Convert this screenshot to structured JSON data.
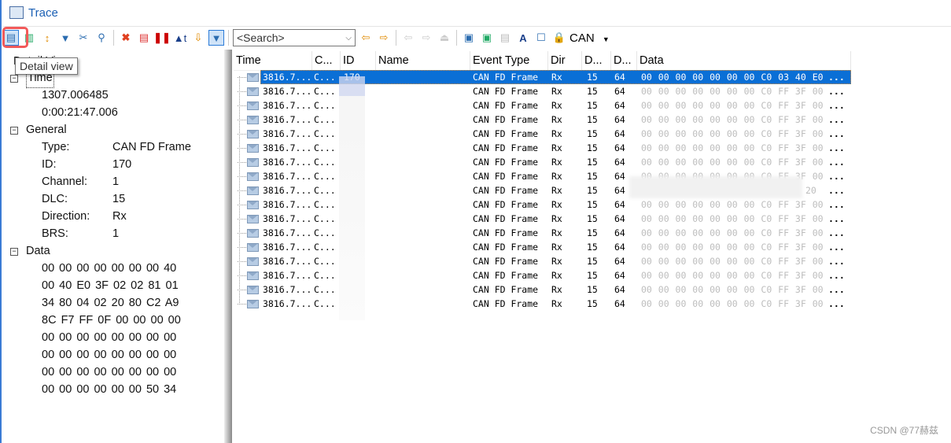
{
  "window": {
    "title": "Trace"
  },
  "toolbar": {
    "buttons": [
      "detail-view",
      "statistics",
      "expand",
      "filter-message",
      "filter-clear",
      "find",
      "delete",
      "clear-filter",
      "pause",
      "time-mode",
      "export",
      "filter-active"
    ],
    "search_placeholder": "<Search>",
    "bus_label": "CAN",
    "tooltip": "Detail view"
  },
  "detail": {
    "title": "Detail View",
    "time": {
      "label": "Time",
      "values": [
        "1307.006485",
        "0:00:21:47.006"
      ]
    },
    "general": {
      "label": "General",
      "fields": [
        {
          "k": "Type:",
          "v": "CAN FD Frame"
        },
        {
          "k": "ID:",
          "v": "170"
        },
        {
          "k": "Channel:",
          "v": "1"
        },
        {
          "k": "DLC:",
          "v": "15"
        },
        {
          "k": "Direction:",
          "v": "Rx"
        },
        {
          "k": "BRS:",
          "v": "1"
        }
      ]
    },
    "data": {
      "label": "Data",
      "lines": [
        "00 00 00 00 00 00 00 40",
        "00 40 E0 3F 02 02 81 01",
        "34 80 04 02 20 80 C2 A9",
        "8C F7 FF 0F 00 00 00 00",
        "00 00 00 00 00 00 00 00",
        "00 00 00 00 00 00 00 00",
        "00 00 00 00 00 00 00 00",
        "00 00 00 00 00 00 50 34"
      ]
    }
  },
  "trace": {
    "columns": [
      "Time",
      "C...",
      "ID",
      "Name",
      "Event Type",
      "Dir",
      "D...",
      "D...",
      "Data"
    ],
    "rows": [
      {
        "time": "3816.7...",
        "ch": "C...",
        "id": "170",
        "type": "CAN FD Frame",
        "dir": "Rx",
        "dlc": "15",
        "len": "64",
        "data": "00 00 00 00 00 00 00 C0 03 40 E0",
        "more": "...",
        "selected": true
      },
      {
        "time": "3816.7...",
        "ch": "C...",
        "id": "",
        "type": "CAN FD Frame",
        "dir": "Rx",
        "dlc": "15",
        "len": "64",
        "data": "00 00 00 00 00 00 00 C0 FF 3F 00",
        "more": "..."
      },
      {
        "time": "3816.7...",
        "ch": "C...",
        "id": "",
        "type": "CAN FD Frame",
        "dir": "Rx",
        "dlc": "15",
        "len": "64",
        "data": "00 00 00 00 00 00 00 C0 FF 3F 00",
        "more": "..."
      },
      {
        "time": "3816.7...",
        "ch": "C...",
        "id": "",
        "type": "CAN FD Frame",
        "dir": "Rx",
        "dlc": "15",
        "len": "64",
        "data": "00 00 00 00 00 00 00 C0 FF 3F 00",
        "more": "..."
      },
      {
        "time": "3816.7...",
        "ch": "C...",
        "id": "",
        "type": "CAN FD Frame",
        "dir": "Rx",
        "dlc": "15",
        "len": "64",
        "data": "00 00 00 00 00 00 00 C0 FF 3F 00",
        "more": "..."
      },
      {
        "time": "3816.7...",
        "ch": "C...",
        "id": "",
        "type": "CAN FD Frame",
        "dir": "Rx",
        "dlc": "15",
        "len": "64",
        "data": "00 00 00 00 00 00 00 C0 FF 3F 00",
        "more": "..."
      },
      {
        "time": "3816.7...",
        "ch": "C...",
        "id": "",
        "type": "CAN FD Frame",
        "dir": "Rx",
        "dlc": "15",
        "len": "64",
        "data": "00 00 00 00 00 00 00 C0 FF 3F 00",
        "more": "..."
      },
      {
        "time": "3816.7...",
        "ch": "C...",
        "id": "",
        "type": "CAN FD Frame",
        "dir": "Rx",
        "dlc": "15",
        "len": "64",
        "data": "00 00 00 00 00 00 00 C0 FF 3F 00",
        "more": "..."
      },
      {
        "time": "3816.7...",
        "ch": "C...",
        "id": "",
        "type": "CAN FD Frame",
        "dir": "Rx",
        "dlc": "15",
        "len": "64",
        "data": "20",
        "more": "..."
      },
      {
        "time": "3816.7...",
        "ch": "C...",
        "id": "",
        "type": "CAN FD Frame",
        "dir": "Rx",
        "dlc": "15",
        "len": "64",
        "data": "00 00 00 00 00 00 00 C0 FF 3F 00",
        "more": "..."
      },
      {
        "time": "3816.7...",
        "ch": "C...",
        "id": "",
        "type": "CAN FD Frame",
        "dir": "Rx",
        "dlc": "15",
        "len": "64",
        "data": "00 00 00 00 00 00 00 C0 FF 3F 00",
        "more": "..."
      },
      {
        "time": "3816.7...",
        "ch": "C...",
        "id": "",
        "type": "CAN FD Frame",
        "dir": "Rx",
        "dlc": "15",
        "len": "64",
        "data": "00 00 00 00 00 00 00 C0 FF 3F 00",
        "more": "..."
      },
      {
        "time": "3816.7...",
        "ch": "C...",
        "id": "",
        "type": "CAN FD Frame",
        "dir": "Rx",
        "dlc": "15",
        "len": "64",
        "data": "00 00 00 00 00 00 00 C0 FF 3F 00",
        "more": "..."
      },
      {
        "time": "3816.7...",
        "ch": "C...",
        "id": "",
        "type": "CAN FD Frame",
        "dir": "Rx",
        "dlc": "15",
        "len": "64",
        "data": "00 00 00 00 00 00 00 C0 FF 3F 00",
        "more": "..."
      },
      {
        "time": "3816.7...",
        "ch": "C...",
        "id": "",
        "type": "CAN FD Frame",
        "dir": "Rx",
        "dlc": "15",
        "len": "64",
        "data": "00 00 00 00 00 00 00 C0 FF 3F 00",
        "more": "..."
      },
      {
        "time": "3816.7...",
        "ch": "C...",
        "id": "",
        "type": "CAN FD Frame",
        "dir": "Rx",
        "dlc": "15",
        "len": "64",
        "data": "00 00 00 00 00 00 00 C0 FF 3F 00",
        "more": "..."
      },
      {
        "time": "3816.7...",
        "ch": "C...",
        "id": "",
        "type": "CAN FD Frame",
        "dir": "Rx",
        "dlc": "15",
        "len": "64",
        "data": "00 00 00 00 00 00 00 C0 FF 3F 00",
        "more": "..."
      }
    ]
  },
  "watermark": "CSDN @77赫兹",
  "colors": {
    "selection": "#0a6fd6",
    "highlight": "#f25a5a",
    "title": "#1a5fb4"
  }
}
